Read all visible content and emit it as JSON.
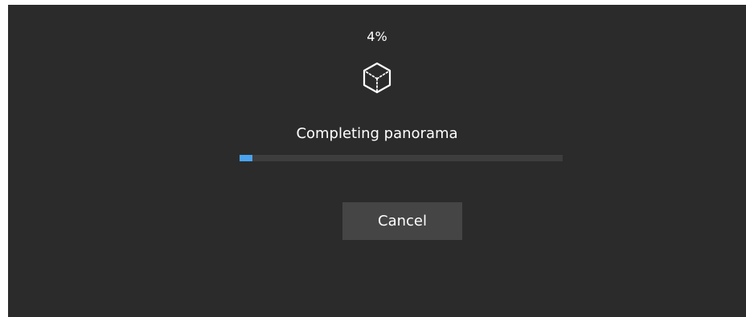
{
  "progress": {
    "percent_label": "4%",
    "value_percent": 4,
    "status_text": "Completing panorama"
  },
  "icon": "cube-icon",
  "actions": {
    "cancel_label": "Cancel"
  },
  "colors": {
    "background": "#2b2b2b",
    "progress_track": "#3d3d3d",
    "progress_fill": "#4aa3f0",
    "button_bg": "#454545",
    "text": "#ffffff"
  }
}
